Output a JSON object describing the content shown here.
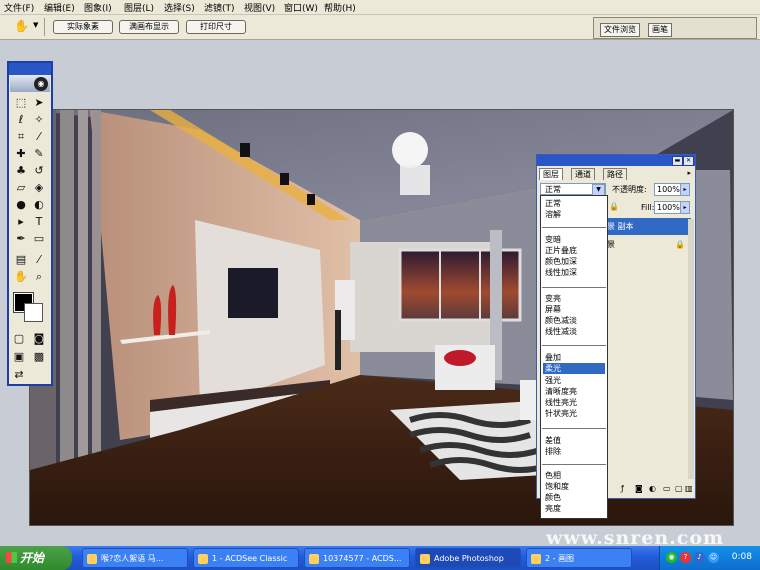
{
  "menu": [
    "文件(F)",
    "编辑(E)",
    "图象(I)",
    "图层(L)",
    "选择(S)",
    "滤镜(T)",
    "视图(V)",
    "窗口(W)",
    "帮助(H)"
  ],
  "options": {
    "actual_pixels": "实际象素",
    "fit_on_screen": "满画布显示",
    "print_size": "打印尺寸",
    "file_browser": "文件浏览",
    "brushes": "画笔"
  },
  "layers_palette": {
    "tabs": [
      "图层",
      "通道",
      "路径"
    ],
    "blend_mode": "正常",
    "opacity_label": "不透明度:",
    "opacity_value": "100%",
    "fill_label": "Fill:",
    "fill_value": "100%",
    "layers": [
      {
        "name": "景 副本",
        "selected": true
      },
      {
        "name": "景",
        "selected": false
      }
    ]
  },
  "blend_modes": [
    [
      "正常",
      "溶解"
    ],
    [
      "变暗",
      "正片叠底",
      "颜色加深",
      "线性加深"
    ],
    [
      "变亮",
      "屏幕",
      "颜色减淡",
      "线性减淡"
    ],
    [
      "叠加",
      "柔光",
      "强光",
      "清晰度亮",
      "线性亮光",
      "针状亮光"
    ],
    [
      "差值",
      "排除"
    ],
    [
      "色相",
      "饱和度",
      "颜色",
      "亮度"
    ]
  ],
  "selected_blend_mode": "柔光",
  "toolbox": {
    "icons": [
      "marquee-icon",
      "move-icon",
      "lasso-icon",
      "magic-wand-icon",
      "crop-icon",
      "slice-icon",
      "healing-icon",
      "brush-icon",
      "stamp-icon",
      "history-brush-icon",
      "eraser-icon",
      "bucket-icon",
      "blur-icon",
      "dodge-icon",
      "path-select-icon",
      "type-icon",
      "pen-icon",
      "shape-icon",
      "notes-icon",
      "eyedropper-icon",
      "hand-icon",
      "zoom-icon"
    ],
    "foreground_color": "#000000",
    "background_color": "#ffffff"
  },
  "watermark": "www.snren.com",
  "taskbar": {
    "start": "开始",
    "items": [
      {
        "label": "喉?恋人絮语 马...",
        "active": false
      },
      {
        "label": "1 - ACDSee Classic",
        "active": false
      },
      {
        "label": "10374577 - ACDS...",
        "active": false
      },
      {
        "label": "Adobe Photoshop",
        "active": true
      },
      {
        "label": "2 - 画图",
        "active": false
      }
    ],
    "clock": "0:08"
  }
}
